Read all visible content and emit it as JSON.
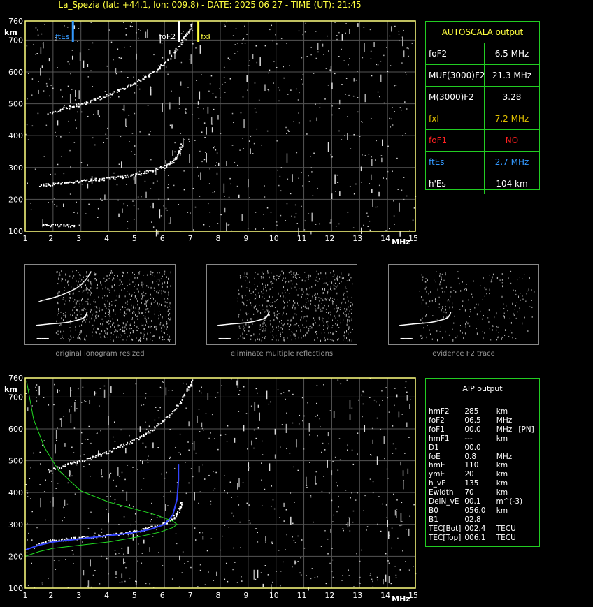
{
  "header": {
    "title": "La_Spezia (lat: +44.1, lon: 009.8) - DATE: 2025 06 27 - TIME (UT): 21:45"
  },
  "autoscala": {
    "title": "AUTOSCALA output",
    "rows": [
      {
        "label": "foF2",
        "value": "6.5 MHz",
        "label_color": "#ffffff",
        "value_color": "#ffffff"
      },
      {
        "label": "MUF(3000)F2",
        "value": "21.3 MHz",
        "label_color": "#ffffff",
        "value_color": "#ffffff"
      },
      {
        "label": "M(3000)F2",
        "value": "3.28",
        "label_color": "#ffffff",
        "value_color": "#ffffff"
      },
      {
        "label": "fxI",
        "value": "7.2 MHz",
        "label_color": "#e0c000",
        "value_color": "#e0c000"
      },
      {
        "label": "foF1",
        "value": "NO",
        "label_color": "#ff2020",
        "value_color": "#ff2020"
      },
      {
        "label": "ftEs",
        "value": "2.7 MHz",
        "label_color": "#3399ff",
        "value_color": "#3399ff"
      },
      {
        "label": "h'Es",
        "value": "104     km",
        "label_color": "#ffffff",
        "value_color": "#ffffff"
      }
    ]
  },
  "aip": {
    "title": "AIP output",
    "rows": [
      [
        "hmF2",
        "285",
        "km",
        ""
      ],
      [
        "foF2",
        "06.5",
        "MHz",
        ""
      ],
      [
        "foF1",
        "00.0",
        "MHz",
        "[PN]"
      ],
      [
        "hmF1",
        "---",
        "km",
        ""
      ],
      [
        "D1",
        "00.0",
        "",
        ""
      ],
      [
        "foE",
        "0.8",
        "MHz",
        ""
      ],
      [
        "hmE",
        "110",
        "km",
        ""
      ],
      [
        "ymE",
        "20",
        "km",
        ""
      ],
      [
        "h_vE",
        "135",
        "km",
        ""
      ],
      [
        "Ewidth",
        "70",
        "km",
        ""
      ],
      [
        "DelN_vE",
        "00.1",
        "m^(-3)",
        ""
      ],
      [
        "B0",
        "056.0",
        "km",
        ""
      ],
      [
        "B1",
        "02.8",
        "",
        ""
      ],
      [
        "TEC[Bot]",
        "002.4",
        "TECU",
        ""
      ],
      [
        "TEC[Top]",
        "006.1",
        "TECU",
        ""
      ]
    ]
  },
  "thumbnails": {
    "captions": [
      "original ionogram resized",
      "eliminate multiple reflections",
      "evidence F2 trace"
    ]
  },
  "markers": {
    "ftEs": {
      "label": "ftEs",
      "freq": 2.7,
      "color": "#3399ff"
    },
    "foF2": {
      "label": "foF2",
      "freq": 6.5,
      "color": "#ffffff"
    },
    "fxI": {
      "label": "fxI",
      "freq": 7.2,
      "color": "#ffff40"
    }
  },
  "chart_data": [
    {
      "type": "scatter",
      "title": "",
      "xlabel": "MHz",
      "ylabel": "km",
      "xlim": [
        1,
        15
      ],
      "ylim": [
        100,
        760
      ],
      "x_ticks": [
        1,
        2,
        3,
        4,
        5,
        6,
        7,
        8,
        9,
        10,
        11,
        12,
        13,
        14,
        15
      ],
      "y_ticks": [
        100,
        200,
        300,
        400,
        500,
        600,
        700,
        760
      ],
      "grid": true,
      "series": [
        {
          "name": "",
          "color": "#ffffff",
          "points": [
            [
              1.5,
              245
            ],
            [
              2,
              250
            ],
            [
              2.5,
              255
            ],
            [
              3,
              260
            ],
            [
              3.5,
              263
            ],
            [
              4,
              267
            ],
            [
              4.5,
              272
            ],
            [
              5,
              280
            ],
            [
              5.5,
              292
            ],
            [
              6,
              305
            ],
            [
              6.3,
              320
            ],
            [
              6.5,
              345
            ],
            [
              6.6,
              375
            ]
          ]
        },
        {
          "name": "",
          "color": "#ffffff",
          "points": [
            [
              1.8,
              470
            ],
            [
              2.5,
              490
            ],
            [
              3,
              500
            ],
            [
              3.5,
              515
            ],
            [
              4,
              530
            ],
            [
              4.5,
              550
            ],
            [
              5,
              570
            ],
            [
              5.5,
              595
            ],
            [
              6,
              630
            ],
            [
              6.5,
              680
            ],
            [
              6.8,
              725
            ],
            [
              7.0,
              755
            ]
          ]
        },
        {
          "name": "",
          "color": "#ffffff",
          "points": [
            [
              1.6,
              120
            ],
            [
              2.2,
              120
            ],
            [
              2.8,
              120
            ]
          ]
        }
      ]
    },
    {
      "type": "scatter",
      "title": "",
      "xlabel": "MHz",
      "ylabel": "km",
      "xlim": [
        1,
        15
      ],
      "ylim": [
        100,
        760
      ],
      "grid": true,
      "series": [
        {
          "name": "",
          "color": "#ffffff",
          "points": [
            [
              1.5,
              245
            ],
            [
              2,
              250
            ],
            [
              2.5,
              255
            ],
            [
              3,
              260
            ],
            [
              3.5,
              263
            ],
            [
              4,
              267
            ],
            [
              4.5,
              272
            ],
            [
              5,
              280
            ],
            [
              5.5,
              292
            ],
            [
              6,
              305
            ],
            [
              6.3,
              320
            ],
            [
              6.5,
              345
            ],
            [
              6.6,
              375
            ]
          ]
        },
        {
          "name": "",
          "color": "#ffffff",
          "points": [
            [
              1.8,
              470
            ],
            [
              2.5,
              490
            ],
            [
              3,
              500
            ],
            [
              3.5,
              515
            ],
            [
              4,
              530
            ],
            [
              4.5,
              550
            ],
            [
              5,
              570
            ],
            [
              5.5,
              595
            ],
            [
              6,
              630
            ],
            [
              6.5,
              680
            ],
            [
              6.8,
              725
            ],
            [
              7.0,
              755
            ]
          ]
        },
        {
          "name": "",
          "color": "#3344ff",
          "points": [
            [
              1.0,
              220
            ],
            [
              1.5,
              235
            ],
            [
              2,
              245
            ],
            [
              2.5,
              250
            ],
            [
              3,
              255
            ],
            [
              3.5,
              260
            ],
            [
              4,
              265
            ],
            [
              4.5,
              270
            ],
            [
              5,
              276
            ],
            [
              5.5,
              285
            ],
            [
              6,
              300
            ],
            [
              6.3,
              330
            ],
            [
              6.45,
              380
            ],
            [
              6.5,
              440
            ],
            [
              6.5,
              490
            ]
          ]
        },
        {
          "name": "",
          "color": "#22dd22",
          "points": [
            [
              1.0,
              200
            ],
            [
              1.5,
              215
            ],
            [
              2,
              225
            ],
            [
              3,
              235
            ],
            [
              4,
              245
            ],
            [
              5,
              260
            ],
            [
              5.8,
              275
            ],
            [
              6.3,
              290
            ],
            [
              6.45,
              300
            ],
            [
              6.3,
              310
            ],
            [
              6,
              320
            ],
            [
              5.5,
              335
            ],
            [
              4,
              370
            ],
            [
              3,
              405
            ],
            [
              2.2,
              470
            ],
            [
              1.7,
              540
            ],
            [
              1.3,
              630
            ],
            [
              1.05,
              750
            ]
          ]
        }
      ]
    }
  ]
}
